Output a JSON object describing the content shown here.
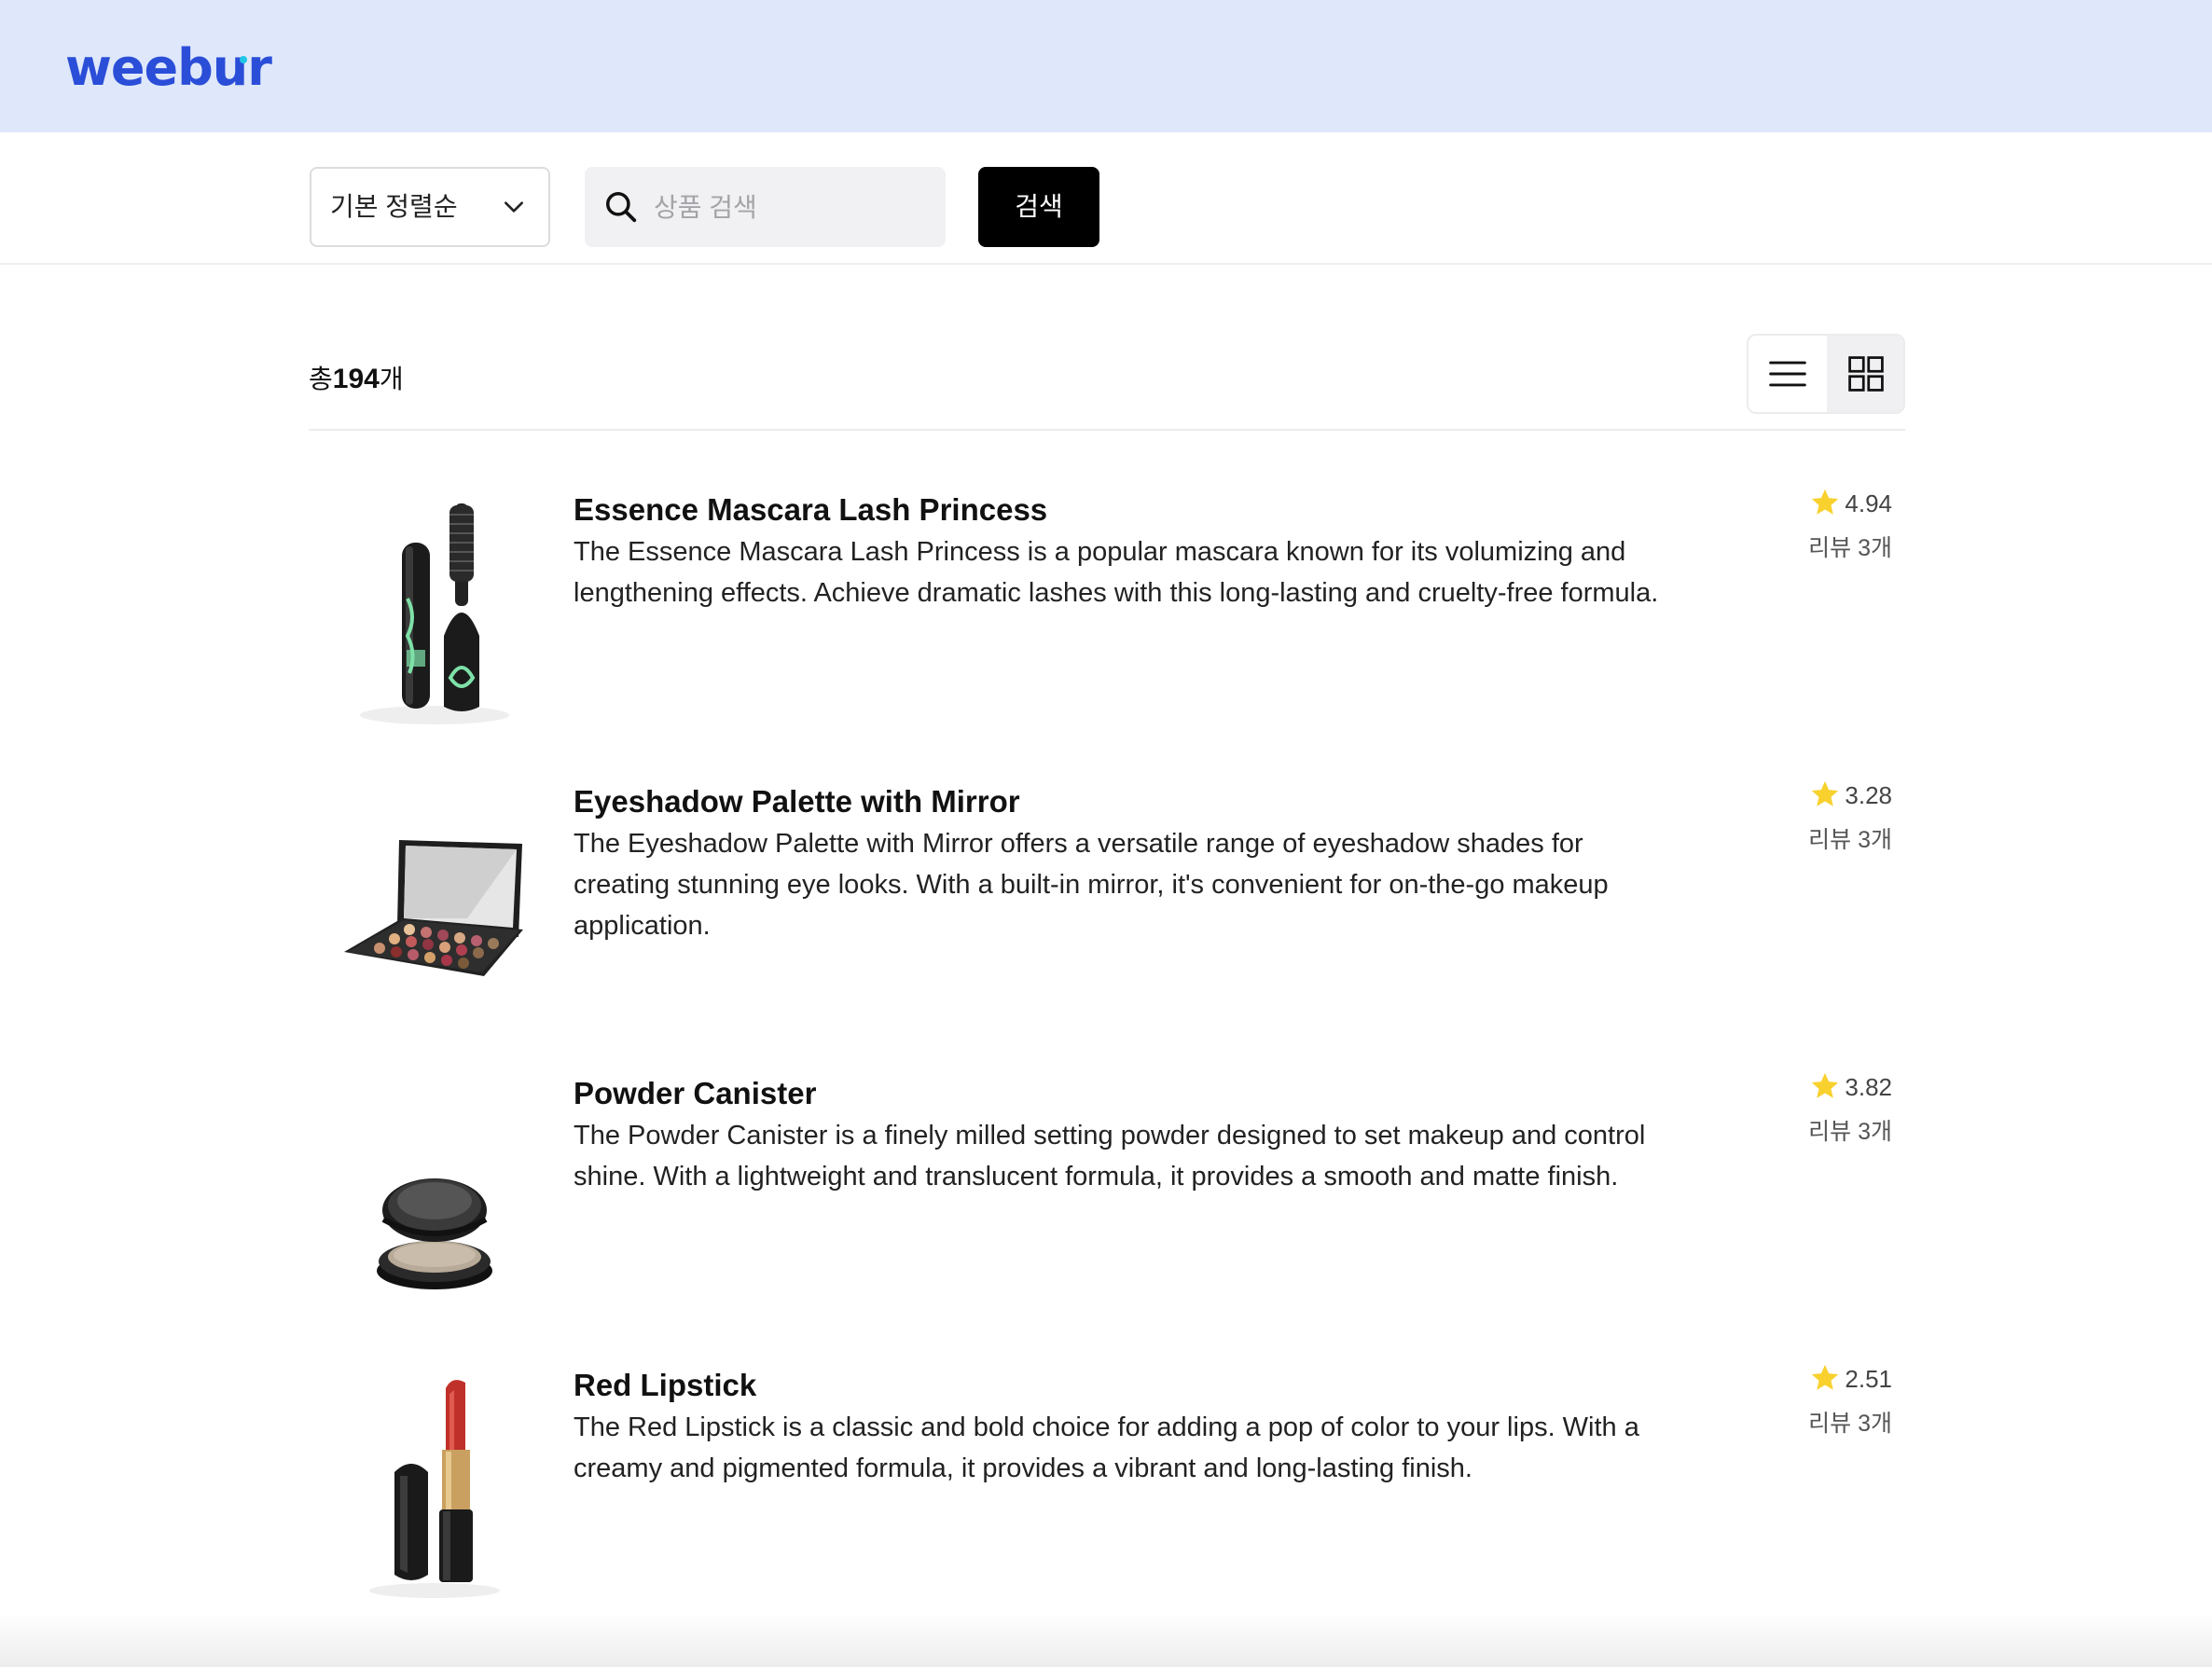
{
  "header": {
    "logo_text": "weebur"
  },
  "toolbar": {
    "sort_selected": "기본 정렬순",
    "search_placeholder": "상품 검색",
    "search_value": "",
    "search_button_label": "검색"
  },
  "list": {
    "total_prefix": "총",
    "total_count": "194",
    "total_suffix": "개",
    "view_modes": [
      "list",
      "grid"
    ]
  },
  "products": [
    {
      "name": "Essence Mascara Lash Princess",
      "description": "The Essence Mascara Lash Princess is a popular mascara known for its volumizing and lengthening effects. Achieve dramatic lashes with this long-lasting and cruelty-free formula.",
      "rating": "4.94",
      "reviews": "리뷰 3개",
      "image_icon": "mascara-icon"
    },
    {
      "name": "Eyeshadow Palette with Mirror",
      "description": "The Eyeshadow Palette with Mirror offers a versatile range of eyeshadow shades for creating stunning eye looks. With a built-in mirror, it's convenient for on-the-go makeup application.",
      "rating": "3.28",
      "reviews": "리뷰 3개",
      "image_icon": "eyeshadow-palette-icon"
    },
    {
      "name": "Powder Canister",
      "description": "The Powder Canister is a finely milled setting powder designed to set makeup and control shine. With a lightweight and translucent formula, it provides a smooth and matte finish.",
      "rating": "3.82",
      "reviews": "리뷰 3개",
      "image_icon": "powder-compact-icon"
    },
    {
      "name": "Red Lipstick",
      "description": "The Red Lipstick is a classic and bold choice for adding a pop of color to your lips. With a creamy and pigmented formula, it provides a vibrant and long-lasting finish.",
      "rating": "2.51",
      "reviews": "리뷰 3개",
      "image_icon": "lipstick-icon"
    }
  ],
  "colors": {
    "header_bg": "#dfe8fa",
    "brand": "#2b4ed8",
    "brand_dot": "#1fc7e6",
    "star": "#f8d12e",
    "button_bg": "#000000"
  }
}
